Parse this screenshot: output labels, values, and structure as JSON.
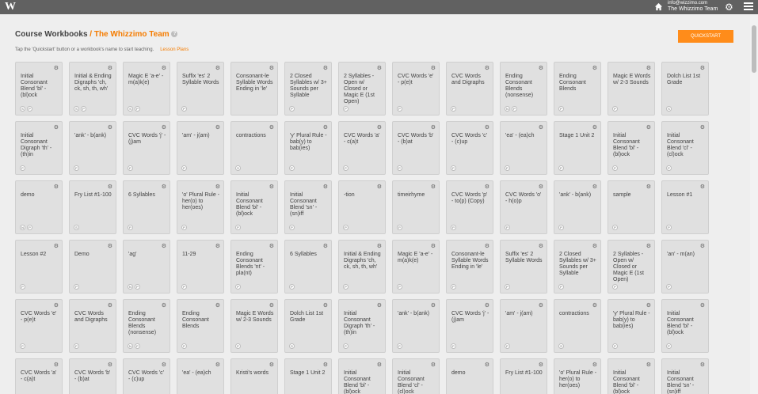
{
  "topbar": {
    "logo": "W",
    "email": "info@wizzimo.com",
    "team": "The Whizzimo Team"
  },
  "header": {
    "title": "Course Workbooks",
    "separator": " / ",
    "team": "The Whizzimo Team",
    "help": "?"
  },
  "instructions": {
    "text": "Tap the 'Quickstart' button or a workbook's name to start teaching.",
    "lesson_plans": "Lesson Plans"
  },
  "quickstart_label": "QUICKSTART",
  "cards": [
    {
      "t": "Initial Consonant Blend 'bl' - (bl)ock",
      "b": [
        "S",
        "P"
      ]
    },
    {
      "t": "Initial & Ending Digraphs 'ch, ck, sh, th, wh'",
      "b": [
        "S",
        "P"
      ]
    },
    {
      "t": "Magic E 'a-e' - m(a)k(e)",
      "b": [
        "S",
        "P"
      ]
    },
    {
      "t": "Suffix 'es' 2 Syllable Words",
      "b": [
        "P"
      ]
    },
    {
      "t": "Consonant-le Syllable Words Ending in 'le'",
      "b": []
    },
    {
      "t": "2 Closed Syllables w/ 3+ Sounds per Syllable",
      "b": [
        "P"
      ]
    },
    {
      "t": "2 Syllables - Open w/ Closed or Magic E (1st Open)",
      "b": [
        "P"
      ]
    },
    {
      "t": "CVC Words 'e' - p(e)t",
      "b": [
        "P"
      ]
    },
    {
      "t": "CVC Words and Digraphs",
      "b": [
        "P"
      ]
    },
    {
      "t": "Ending Consonant Blends (nonsense)",
      "b": [
        "N",
        "P"
      ]
    },
    {
      "t": "Ending Consonant Blends",
      "b": [
        "P"
      ]
    },
    {
      "t": "Magic E Words w/ 2-3 Sounds",
      "b": [
        "P"
      ]
    },
    {
      "t": "Dolch List 1st Grade",
      "b": [
        "S"
      ]
    },
    {
      "t": "Initial Consonant Digraph 'th' - (th)in",
      "b": [
        "P"
      ]
    },
    {
      "t": "'ank' - b(ank)",
      "b": [
        "P"
      ]
    },
    {
      "t": "CVC Words 'j' - (j)am",
      "b": [
        "P"
      ]
    },
    {
      "t": "'am' - j(am)",
      "b": [
        "P"
      ]
    },
    {
      "t": "contractions",
      "b": [
        "S"
      ]
    },
    {
      "t": "'y' Plural Rule - bab(y) to bab(ies)",
      "b": [
        "P"
      ]
    },
    {
      "t": "CVC Words 'a' - c(a)t",
      "b": [
        "P"
      ]
    },
    {
      "t": "CVC Words 'b' - (b)at",
      "b": [
        "P"
      ]
    },
    {
      "t": "CVC Words 'c' - (c)up",
      "b": [
        "P"
      ]
    },
    {
      "t": "'ea' - (ea)ch",
      "b": [
        "P"
      ]
    },
    {
      "t": "Stage 1 Unit 2",
      "b": [
        "P"
      ]
    },
    {
      "t": "Initial Consonant Blend 'bl' - (bl)ock",
      "b": [
        "P"
      ]
    },
    {
      "t": "Initial Consonant Blend 'cl' - (cl)ock",
      "b": [
        "P"
      ]
    },
    {
      "t": "demo",
      "b": [
        "N",
        "P"
      ]
    },
    {
      "t": "Fry List #1-100",
      "b": [
        "S"
      ]
    },
    {
      "t": "6 Syllables",
      "b": [
        "P"
      ]
    },
    {
      "t": "'o' Plural Rule - her(o) to her(oes)",
      "b": [
        "P"
      ]
    },
    {
      "t": "Initial Consonant Blend 'bl' - (bl)ock",
      "b": [
        "P"
      ]
    },
    {
      "t": "Initial Consonant Blend 'sn' - (sn)iff",
      "b": [
        "P"
      ]
    },
    {
      "t": "-tion",
      "b": [
        "P"
      ]
    },
    {
      "t": "timeirhyme",
      "b": [
        "P"
      ]
    },
    {
      "t": "CVC Words 'p' - to(p) (Copy)",
      "b": [
        "P"
      ]
    },
    {
      "t": "CVC Words 'o' - h(o)p",
      "b": [
        "P"
      ]
    },
    {
      "t": "'ank' - b(ank)",
      "b": [
        "P"
      ]
    },
    {
      "t": "sample",
      "b": [
        "P"
      ]
    },
    {
      "t": "Lesson #1",
      "b": [
        "P"
      ]
    },
    {
      "t": "Lesson #2",
      "b": [
        "P"
      ]
    },
    {
      "t": "Demo",
      "b": [
        "P"
      ]
    },
    {
      "t": "'ag'",
      "b": [
        "N",
        "P"
      ]
    },
    {
      "t": "11-29",
      "b": [
        "P"
      ]
    },
    {
      "t": "Ending Consonant Blends 'nt' - pla(nt)",
      "b": [
        "P"
      ]
    },
    {
      "t": "6 Syllables",
      "b": [
        "P"
      ]
    },
    {
      "t": "Initial & Ending Digraphs 'ch, ck, sh, th, wh'",
      "b": [
        "P"
      ]
    },
    {
      "t": "Magic E 'a-e' - m(a)k(e)",
      "b": [
        "P"
      ]
    },
    {
      "t": "Consonant-le Syllable Words Ending in 'le'",
      "b": [
        "P"
      ]
    },
    {
      "t": "Suffix 'es' 2 Syllable Words",
      "b": [
        "P"
      ]
    },
    {
      "t": "2 Closed Syllables w/ 3+ Sounds per Syllable",
      "b": [
        "P"
      ]
    },
    {
      "t": "2 Syllables - Open w/ Closed or Magic E (1st Open)",
      "b": [
        "P"
      ]
    },
    {
      "t": "'an' - m(an)",
      "b": [
        "P"
      ]
    },
    {
      "t": "CVC Words 'e' - p(e)t",
      "b": [
        "P"
      ]
    },
    {
      "t": "CVC Words and Digraphs",
      "b": [
        "P"
      ]
    },
    {
      "t": "Ending Consonant Blends (nonsense)",
      "b": [
        "N",
        "P"
      ]
    },
    {
      "t": "Ending Consonant Blends",
      "b": [
        "P"
      ]
    },
    {
      "t": "Magic E Words w/ 2-3 Sounds",
      "b": [
        "P"
      ]
    },
    {
      "t": "Dolch List 1st Grade",
      "b": [
        "S"
      ]
    },
    {
      "t": "Initial Consonant Digraph 'th' - (th)in",
      "b": [
        "P"
      ]
    },
    {
      "t": "'ank' - b(ank)",
      "b": [
        "P"
      ]
    },
    {
      "t": "CVC Words 'j' - (j)am",
      "b": [
        "P"
      ]
    },
    {
      "t": "'am' - j(am)",
      "b": [
        "P"
      ]
    },
    {
      "t": "contractions",
      "b": [
        "S"
      ]
    },
    {
      "t": "'y' Plural Rule - bab(y) to bab(ies)",
      "b": [
        "P"
      ]
    },
    {
      "t": "Initial Consonant Blend 'bl' - (bl)ock",
      "b": [
        "P"
      ]
    },
    {
      "t": "CVC Words 'a' - c(a)t",
      "b": [
        "P"
      ]
    },
    {
      "t": "CVC Words 'b' - (b)at",
      "b": [
        "P"
      ]
    },
    {
      "t": "CVC Words 'c' - (c)up",
      "b": [
        "P"
      ]
    },
    {
      "t": "'ea' - (ea)ch",
      "b": [
        "P"
      ]
    },
    {
      "t": "Kristi's words",
      "b": [
        "P"
      ]
    },
    {
      "t": "Stage 1 Unit 2",
      "b": [
        "P"
      ]
    },
    {
      "t": "Initial Consonant Blend 'bl' - (bl)ock",
      "b": [
        "P"
      ]
    },
    {
      "t": "Initial Consonant Blend 'cl' - (cl)ock",
      "b": [
        "P"
      ]
    },
    {
      "t": "demo",
      "b": [
        "P"
      ]
    },
    {
      "t": "Fry List #1-100",
      "b": [
        "P"
      ]
    },
    {
      "t": "'o' Plural Rule - her(o) to her(oes)",
      "b": [
        "P"
      ]
    },
    {
      "t": "Initial Consonant Blend 'bl' - (bl)ock",
      "b": [
        "P"
      ]
    },
    {
      "t": "Initial Consonant Blend 'sn' - (sn)iff",
      "b": [
        "P"
      ]
    }
  ]
}
